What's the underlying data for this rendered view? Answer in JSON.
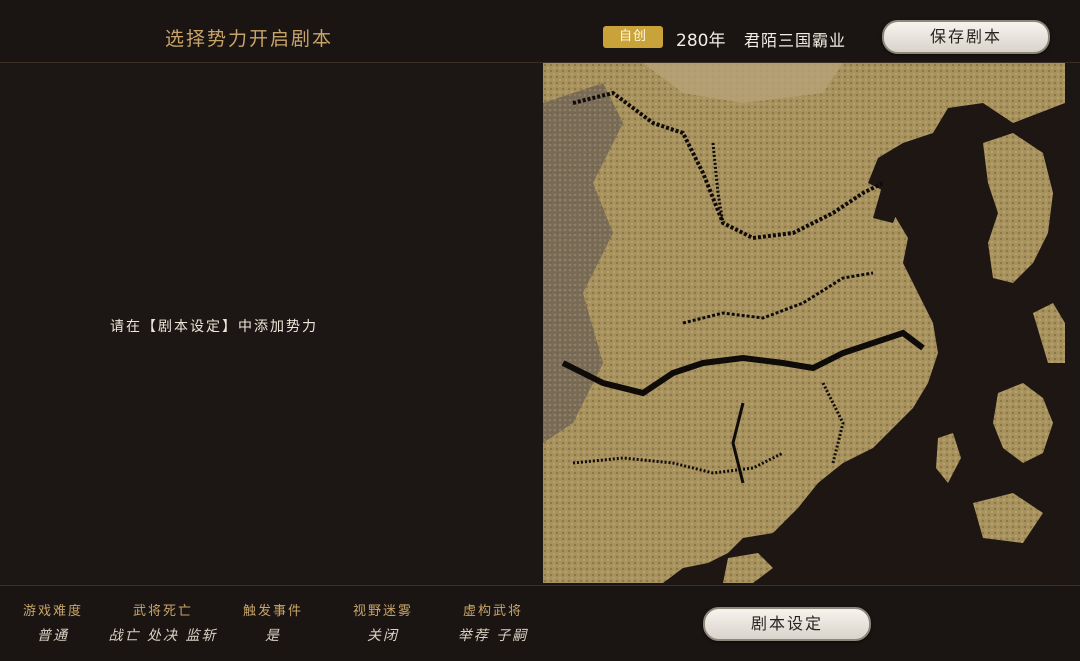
{
  "header": {
    "title": "选择势力开启剧本",
    "badge": "自创",
    "year": "280年",
    "scenario_name": "君陌三国霸业",
    "save_button": "保存剧本"
  },
  "main": {
    "hint": "请在【剧本设定】中添加势力"
  },
  "footer": {
    "stats": [
      {
        "label": "游戏难度",
        "value": "普通"
      },
      {
        "label": "武将死亡",
        "value": "战亡 处决 监斩"
      },
      {
        "label": "触发事件",
        "value": "是"
      },
      {
        "label": "视野迷雾",
        "value": "关闭"
      },
      {
        "label": "虚构武将",
        "value": "举荐 子嗣"
      }
    ],
    "setting_button": "剧本设定"
  },
  "colors": {
    "accent": "#c8a46a",
    "badge": "#c9a23a",
    "land": "#a8925e",
    "sea": "#1d1612"
  }
}
